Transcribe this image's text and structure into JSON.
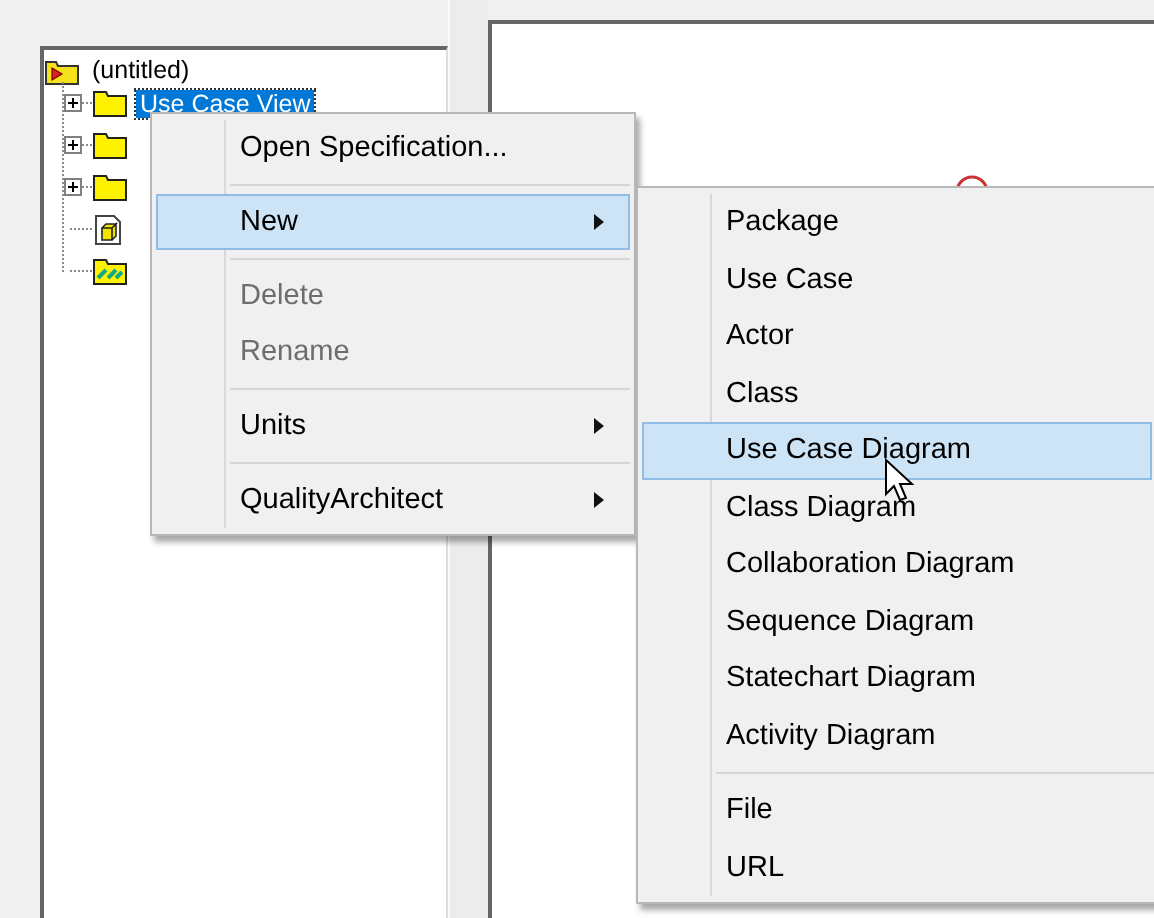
{
  "tree": {
    "root": {
      "label": "(untitled)",
      "expanded": true,
      "children": [
        {
          "kind": "package",
          "label": "Use Case View",
          "selected": true,
          "expandable": true
        },
        {
          "kind": "package",
          "expandable": true
        },
        {
          "kind": "package",
          "expandable": true
        },
        {
          "kind": "component",
          "expandable": false
        },
        {
          "kind": "diagram",
          "expandable": false
        }
      ]
    }
  },
  "context_menu": {
    "items": [
      {
        "kind": "item",
        "label": "Open Specification...",
        "selected": false,
        "disabled": false,
        "submenu": false
      },
      {
        "kind": "separator"
      },
      {
        "kind": "item",
        "label": "New",
        "selected": true,
        "disabled": false,
        "submenu": true
      },
      {
        "kind": "separator"
      },
      {
        "kind": "item",
        "label": "Delete",
        "selected": false,
        "disabled": true,
        "submenu": false
      },
      {
        "kind": "item",
        "label": "Rename",
        "selected": false,
        "disabled": true,
        "submenu": false
      },
      {
        "kind": "separator"
      },
      {
        "kind": "item",
        "label": "Units",
        "selected": false,
        "disabled": false,
        "submenu": true
      },
      {
        "kind": "separator"
      },
      {
        "kind": "item",
        "label": "QualityArchitect",
        "selected": false,
        "disabled": false,
        "submenu": true
      }
    ]
  },
  "submenu": {
    "items": [
      {
        "kind": "item",
        "label": "Package",
        "selected": false
      },
      {
        "kind": "item",
        "label": "Use Case",
        "selected": false
      },
      {
        "kind": "item",
        "label": "Actor",
        "selected": false
      },
      {
        "kind": "item",
        "label": "Class",
        "selected": false
      },
      {
        "kind": "item",
        "label": "Use Case Diagram",
        "selected": true
      },
      {
        "kind": "item",
        "label": "Class Diagram",
        "selected": false
      },
      {
        "kind": "item",
        "label": "Collaboration Diagram",
        "selected": false
      },
      {
        "kind": "item",
        "label": "Sequence Diagram",
        "selected": false
      },
      {
        "kind": "item",
        "label": "Statechart Diagram",
        "selected": false
      },
      {
        "kind": "item",
        "label": "Activity Diagram",
        "selected": false
      },
      {
        "kind": "separator"
      },
      {
        "kind": "item",
        "label": "File",
        "selected": false
      },
      {
        "kind": "item",
        "label": "URL",
        "selected": false
      }
    ]
  }
}
